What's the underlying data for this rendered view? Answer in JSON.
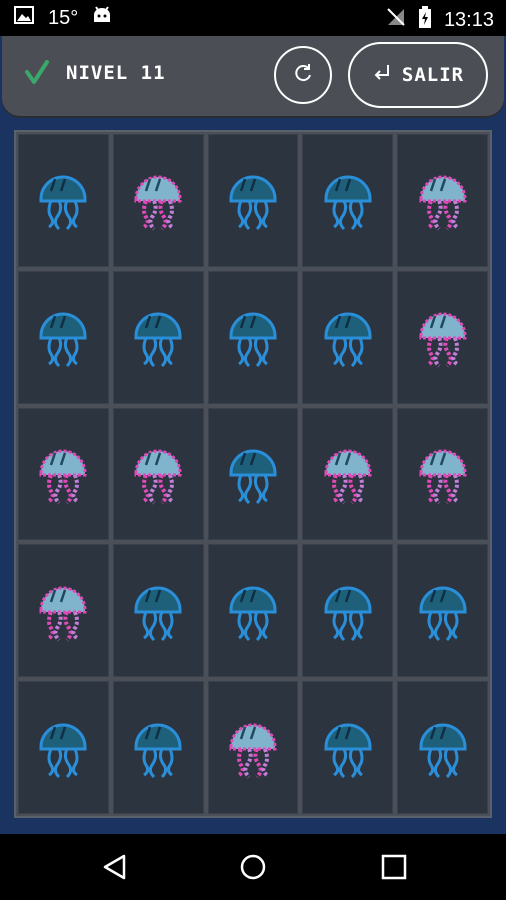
{
  "status": {
    "temperature": "15°",
    "time": "13:13"
  },
  "header": {
    "level_label": "NIVEL 11",
    "exit_label": "SALIR"
  },
  "board": {
    "rows": [
      [
        "blue",
        "pink",
        "blue",
        "blue",
        "pink"
      ],
      [
        "blue",
        "blue",
        "blue",
        "blue",
        "pink"
      ],
      [
        "pink",
        "pink",
        "blue",
        "pink",
        "pink"
      ],
      [
        "pink",
        "blue",
        "blue",
        "blue",
        "blue"
      ],
      [
        "blue",
        "blue",
        "pink",
        "blue",
        "blue"
      ]
    ]
  },
  "colors": {
    "accent_check": "#3aa86b",
    "board_bg": "#1b3360"
  },
  "icons": {
    "jellyfish_blue": "jellyfish-blue-icon",
    "jellyfish_pink": "jellyfish-pink-icon"
  }
}
